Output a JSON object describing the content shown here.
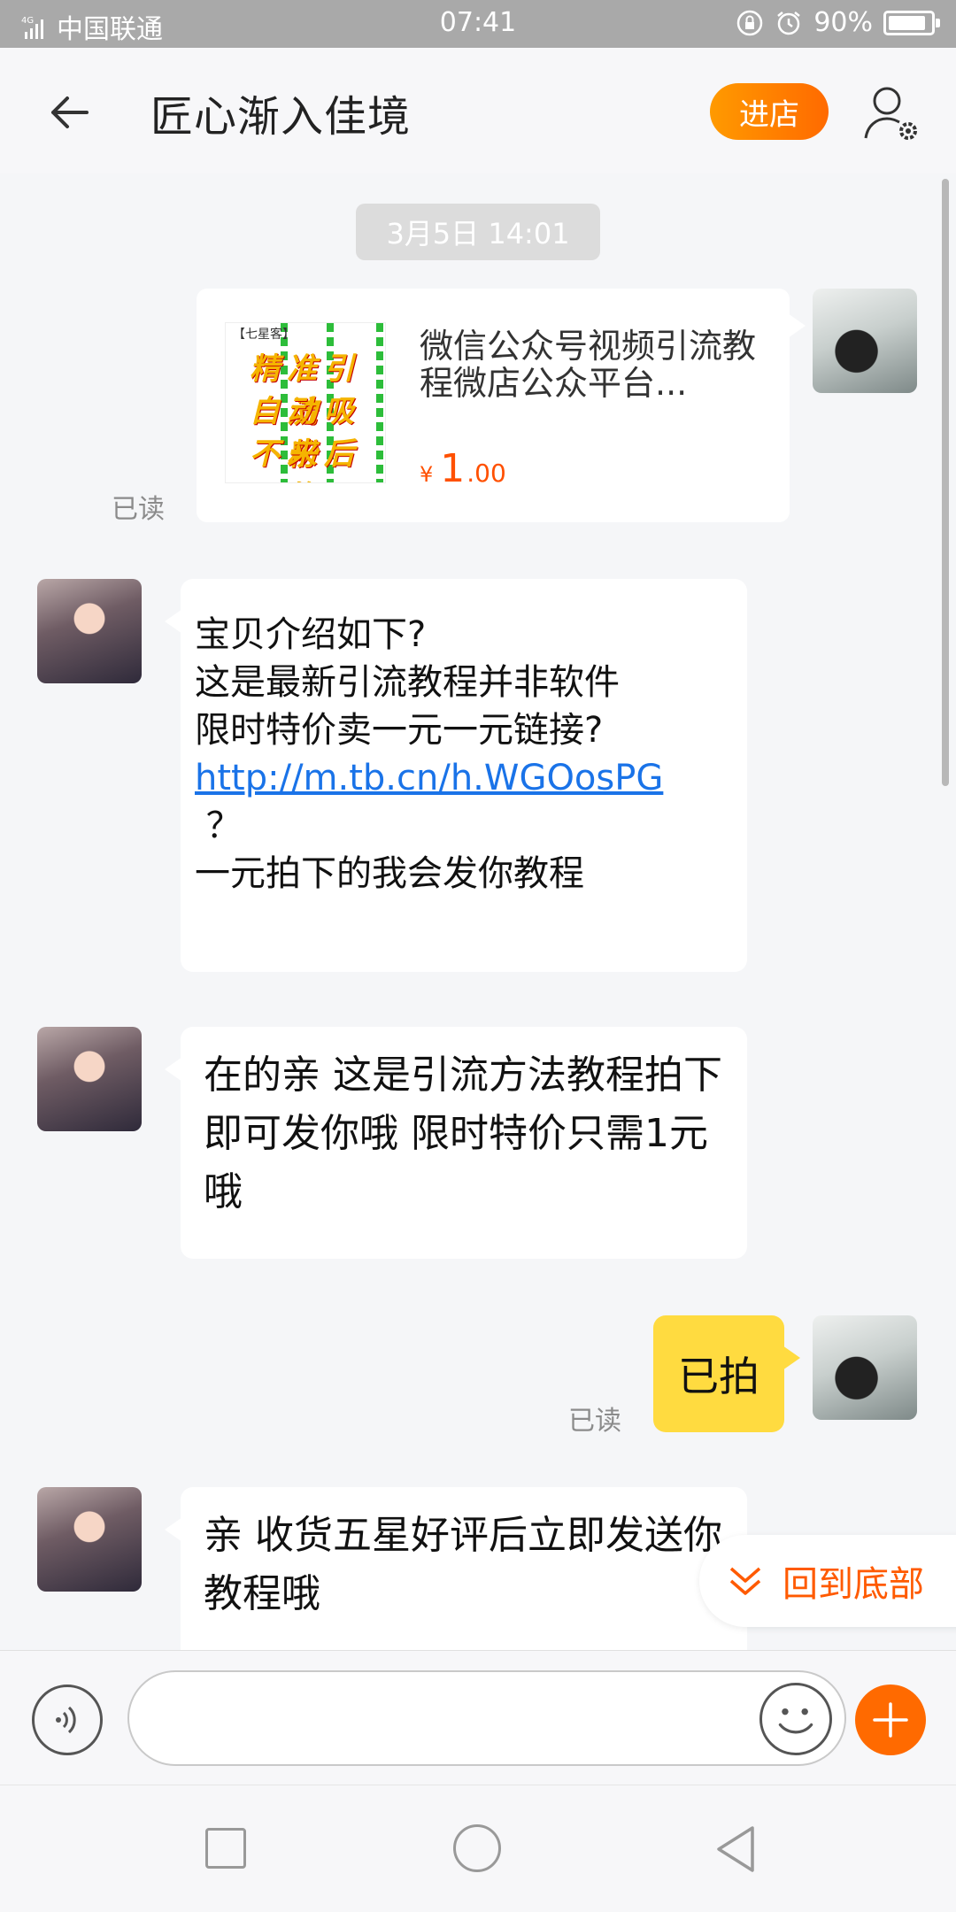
{
  "status_bar": {
    "network": "4G",
    "carrier": "中国联通",
    "time": "07:41",
    "battery": "90%",
    "battery_level": 0.9
  },
  "header": {
    "title": "匠心渐入佳境",
    "shop_button": "进店",
    "accent_color": "#ff6a00"
  },
  "chat": {
    "timestamp": "3月5日 14:01",
    "product": {
      "image_text": {
        "tag": "【七星客】",
        "lines": [
          "精准引流",
          "自动吸粉",
          "不来后悔"
        ]
      },
      "title": "微信公众号视频引流教程微店公众平台...",
      "currency": "¥",
      "price_int": "1",
      "price_dec": ".00",
      "read_label": "已读"
    },
    "msg1": {
      "line1": "宝贝介绍如下?",
      "line2": "这是最新引流教程并非软件",
      "line3": "限时特价卖一元一元链接?",
      "link": "http://m.tb.cn/h.WGOosPG",
      "line4": " ？",
      "line5": "一元拍下的我会发你教程"
    },
    "msg2": {
      "text": "在的亲 这是引流方法教程拍下即可发你哦 限时特价只需1元哦"
    },
    "msg3": {
      "text": "已拍",
      "read_label": "已读"
    },
    "msg4": {
      "text": "亲  收货五星好评后立即发送你教程哦"
    }
  },
  "jump_to_bottom": "回到底部",
  "icons": {
    "back": "back-arrow-icon",
    "profile": "user-settings-icon",
    "voice": "voice-icon",
    "emoji": "emoji-icon",
    "add": "plus-icon"
  }
}
